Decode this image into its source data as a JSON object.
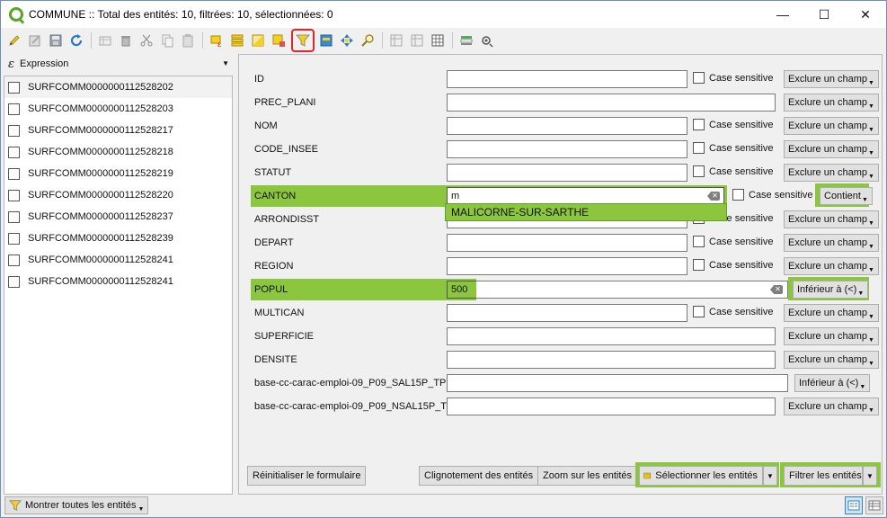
{
  "window": {
    "title": "COMMUNE :: Total des entités: 10, filtrées: 10, sélectionnées: 0",
    "controls": {
      "minimize": "—",
      "maximize": "☐",
      "close": "✕"
    }
  },
  "toolbar": {
    "icons": [
      "pencil-icon",
      "edit-multiple-icon",
      "save-icon",
      "refresh-icon",
      "add-feature-icon",
      "delete-icon",
      "cut-icon",
      "copy-icon",
      "paste-icon",
      "select-expression-icon",
      "select-all-icon",
      "invert-selection-icon",
      "deselect-icon",
      "filter-icon",
      "move-selection-top-icon",
      "pan-to-selection-icon",
      "zoom-to-selection-icon",
      "new-field-icon",
      "delete-field-icon",
      "field-calculator-icon",
      "conditional-format-icon",
      "actions-icon"
    ],
    "active_icon": "filter-icon",
    "highlight_color": "#e0262a"
  },
  "sidebar": {
    "header_label": "Expression",
    "items": [
      {
        "label": "SURFCOMM0000000112528202"
      },
      {
        "label": "SURFCOMM0000000112528203"
      },
      {
        "label": "SURFCOMM0000000112528217"
      },
      {
        "label": "SURFCOMM0000000112528218"
      },
      {
        "label": "SURFCOMM0000000112528219"
      },
      {
        "label": "SURFCOMM0000000112528220"
      },
      {
        "label": "SURFCOMM0000000112528237"
      },
      {
        "label": "SURFCOMM0000000112528239"
      },
      {
        "label": "SURFCOMM0000000112528241"
      },
      {
        "label": "SURFCOMM0000000112528241"
      }
    ]
  },
  "form": {
    "case_label": "Case sensitive",
    "fields": [
      {
        "name": "ID",
        "value": "",
        "button": "Exclure un champ"
      },
      {
        "name": "PREC_PLANI",
        "value": "",
        "button": "Exclure un champ"
      },
      {
        "name": "NOM",
        "value": "",
        "button": "Exclure un champ"
      },
      {
        "name": "CODE_INSEE",
        "value": "",
        "button": "Exclure un champ"
      },
      {
        "name": "STATUT",
        "value": "",
        "button": "Exclure un champ"
      },
      {
        "name": "CANTON",
        "value": "m",
        "button": "Contient"
      },
      {
        "name": "ARRONDISST",
        "value": "",
        "button": "Exclure un champ"
      },
      {
        "name": "DEPART",
        "value": "",
        "button": "Exclure un champ"
      },
      {
        "name": "REGION",
        "value": "",
        "button": "Exclure un champ"
      },
      {
        "name": "POPUL",
        "value": "500",
        "button": "Inférieur à (<)"
      },
      {
        "name": "MULTICAN",
        "value": "",
        "button": "Exclure un champ"
      },
      {
        "name": "SUPERFICIE",
        "value": "",
        "button": "Exclure un champ"
      },
      {
        "name": "DENSITE",
        "value": "",
        "button": "Exclure un champ"
      },
      {
        "name": "base-cc-carac-emploi-09_P09_SAL15P_TP",
        "value": "",
        "button": "Inférieur à (<)"
      },
      {
        "name": "base-cc-carac-emploi-09_P09_NSAL15P_TP",
        "value": "",
        "button": "Exclure un champ"
      }
    ],
    "autocomplete": "MALICORNE-SUR-SARTHE",
    "highlight_color": "#8cc63e"
  },
  "bottom": {
    "reset": "Réinitialiser le formulaire",
    "flash": "Clignotement des entités",
    "zoom": "Zoom sur les entités",
    "select": "Sélectionner les entités",
    "filter": "Filtrer les entités"
  },
  "status": {
    "show_all": "Montrer toutes les entités"
  }
}
